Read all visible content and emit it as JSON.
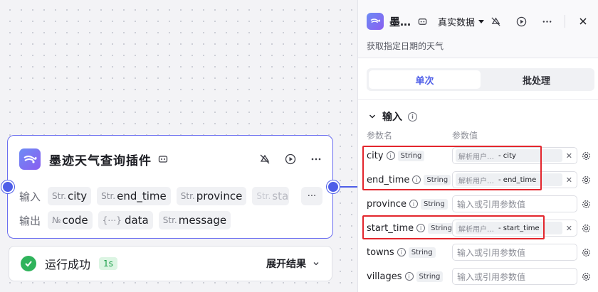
{
  "node": {
    "title": "墨迹天气查询插件",
    "input_label": "输入",
    "output_label": "输出",
    "inputs": [
      {
        "type": "Str.",
        "name": "city"
      },
      {
        "type": "Str.",
        "name": "end_time"
      },
      {
        "type": "Str.",
        "name": "province"
      },
      {
        "type": "Str.",
        "name": "star"
      }
    ],
    "outputs": [
      {
        "type": "№",
        "name": "code"
      },
      {
        "type": "{⋯}",
        "name": "data"
      },
      {
        "type": "Str.",
        "name": "message"
      }
    ],
    "more": "···"
  },
  "status": {
    "text": "运行成功",
    "time": "1s",
    "expand_label": "展开结果"
  },
  "panel": {
    "title": "墨…",
    "data_select": "真实数据",
    "description": "获取指定日期的天气",
    "tabs": [
      {
        "label": "单次",
        "active": true
      },
      {
        "label": "批处理",
        "active": false
      }
    ],
    "section_title": "输入",
    "col_name": "参数名",
    "col_value": "参数值",
    "ref_source": "解析用户…",
    "placeholder": "输入或引用参数值",
    "params": [
      {
        "name": "city",
        "type": "String",
        "ref": "city"
      },
      {
        "name": "end_time",
        "type": "String",
        "ref": "end_time"
      },
      {
        "name": "province",
        "type": "String",
        "ref": ""
      },
      {
        "name": "start_time",
        "type": "String",
        "ref": "start_time"
      },
      {
        "name": "towns",
        "type": "String",
        "ref": ""
      },
      {
        "name": "villages",
        "type": "String",
        "ref": ""
      }
    ]
  },
  "colors": {
    "accent": "#4e5ee8",
    "success": "#2fb35b",
    "highlight": "#e3262d"
  }
}
